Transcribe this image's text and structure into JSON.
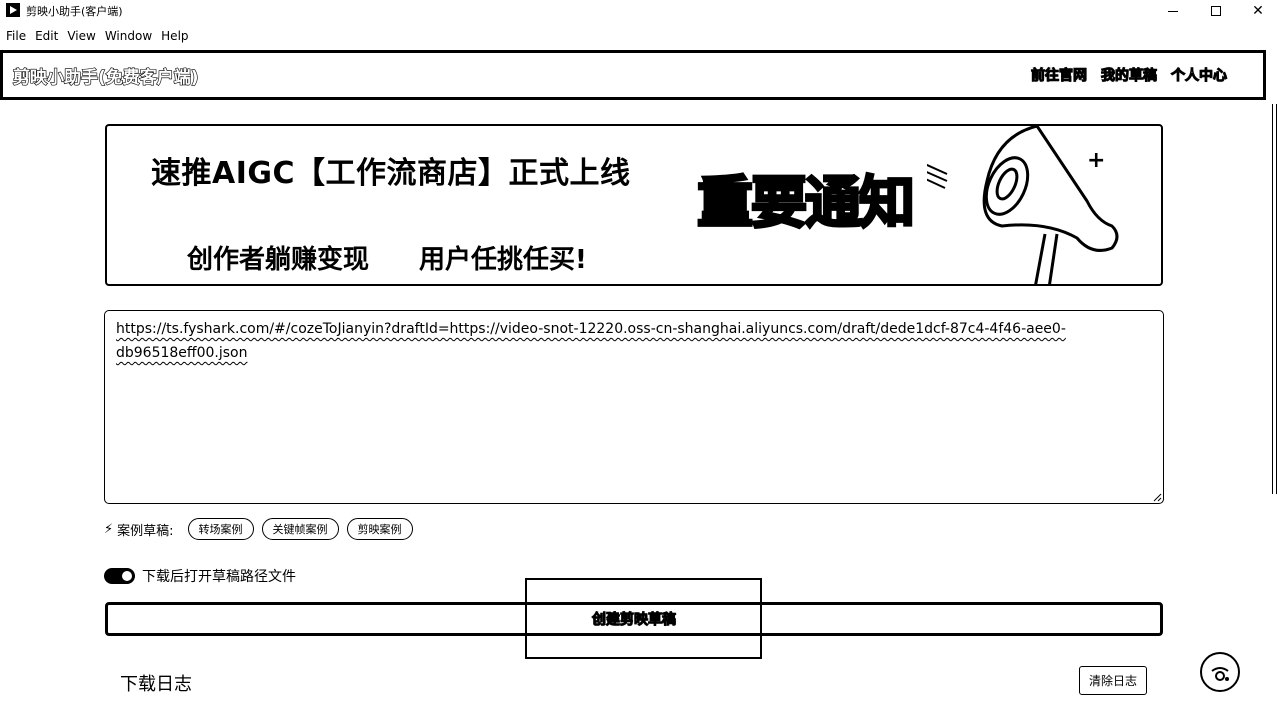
{
  "window": {
    "title": "剪映小助手(客户端)"
  },
  "menu": {
    "items": [
      "File",
      "Edit",
      "View",
      "Window",
      "Help"
    ]
  },
  "header": {
    "title": "剪映小助手(免费客户端)",
    "links": [
      "前往官网",
      "我的草稿",
      "个人中心"
    ]
  },
  "banner": {
    "headline": "速推AIGC【工作流商店】正式上线",
    "notice": "重要通知",
    "sub_left": "创作者躺赚变现",
    "sub_right": "用户任挑任买!"
  },
  "draft_url": {
    "value": "https://ts.fyshark.com/#/cozeToJianyin?draftId=https://video-snot-12220.oss-cn-shanghai.aliyuncs.com/draft/dede1dcf-87c4-4f46-aee0-db96518eff00.json"
  },
  "samples": {
    "label": "案例草稿:",
    "chips": [
      "转场案例",
      "关键帧案例",
      "剪映案例"
    ]
  },
  "toggle": {
    "label": "下载后打开草稿路径文件",
    "on": true
  },
  "create_button": {
    "label": "创建剪映草稿"
  },
  "log": {
    "title": "下载日志",
    "clear_label": "清除日志"
  }
}
